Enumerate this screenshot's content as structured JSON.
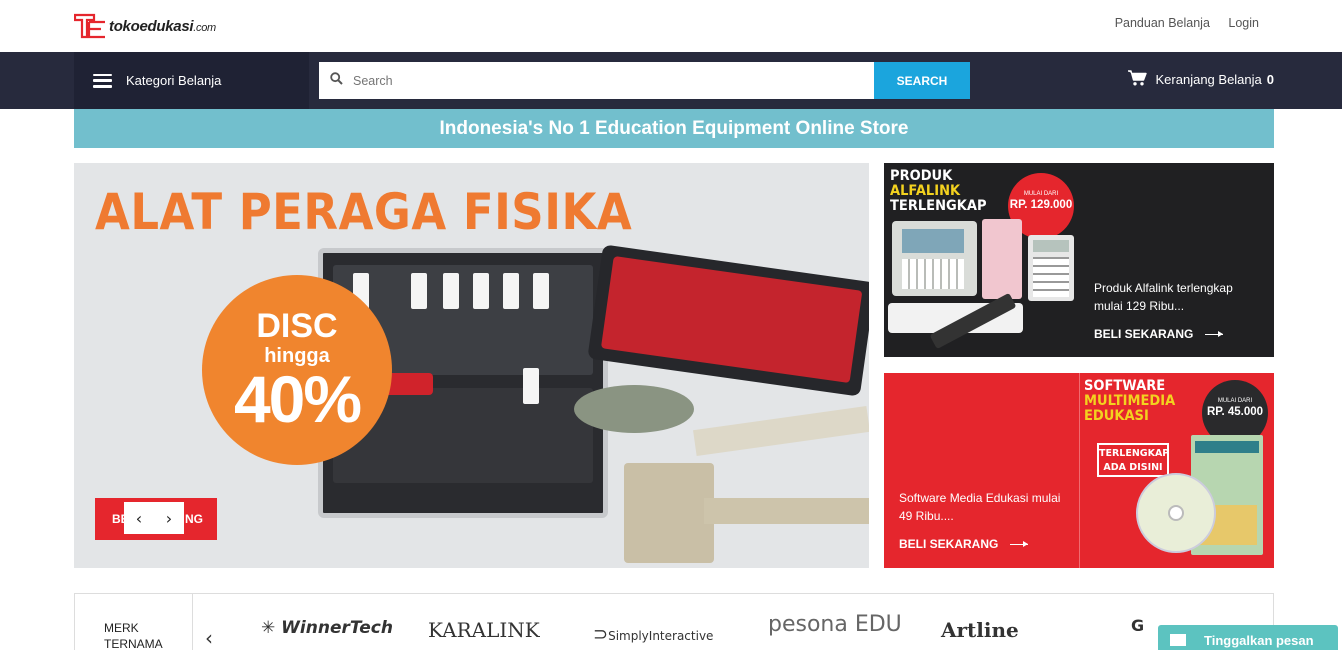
{
  "header": {
    "logo_text": "tokoedukasi",
    "logo_domain": ".com",
    "links": [
      "Panduan Belanja",
      "Login"
    ]
  },
  "nav": {
    "category_label": "Kategori Belanja",
    "search_placeholder": "Search",
    "search_button": "SEARCH",
    "cart_label": "Keranjang Belanja",
    "cart_count": "0"
  },
  "strip_text": "Indonesia's No 1 Education Equipment Online Store",
  "hero": {
    "title": "ALAT PERAGA FISIKA",
    "disc_line1": "DISC",
    "disc_line2": "hingga",
    "disc_line3": "40%",
    "cta_left": "BE",
    "cta_right": "NG",
    "prev": "‹",
    "next": "›"
  },
  "promo1": {
    "head_1": "PRODUK",
    "head_2": "ALFALINK",
    "head_3": "TERLENGKAP",
    "badge_small": "MULAI DARI",
    "badge_price": "RP. 129.000",
    "desc_1": "Produk Alfalink terlengkap",
    "desc_2": "mulai 129 Ribu...",
    "cta": "BELI SEKARANG"
  },
  "promo2": {
    "head_1": "SOFTWARE",
    "head_2": "MULTIMEDIA",
    "head_3": "EDUKASI",
    "badge_small": "MULAI DARI",
    "badge_price": "RP. 45.000",
    "tag_1": "TERLENGKAP",
    "tag_2": "ADA DISINI",
    "desc_1": "Software Media Edukasi mulai",
    "desc_2": "49 Ribu....",
    "cta": "BELI SEKARANG"
  },
  "brands": {
    "label_1": "MERK",
    "label_2": "TERNAMA",
    "prev": "‹",
    "items": [
      "WinnerTech",
      "KARALINK",
      "SimplyInteractive",
      "pesona EDU",
      "Artline",
      "G"
    ]
  },
  "chat_label": "Tinggalkan pesan",
  "colors": {
    "nav_bg": "#272a3d",
    "accent_blue": "#1ba5dd",
    "strip": "#72bfcd",
    "orange": "#ef7a31",
    "red": "#e5262d"
  }
}
